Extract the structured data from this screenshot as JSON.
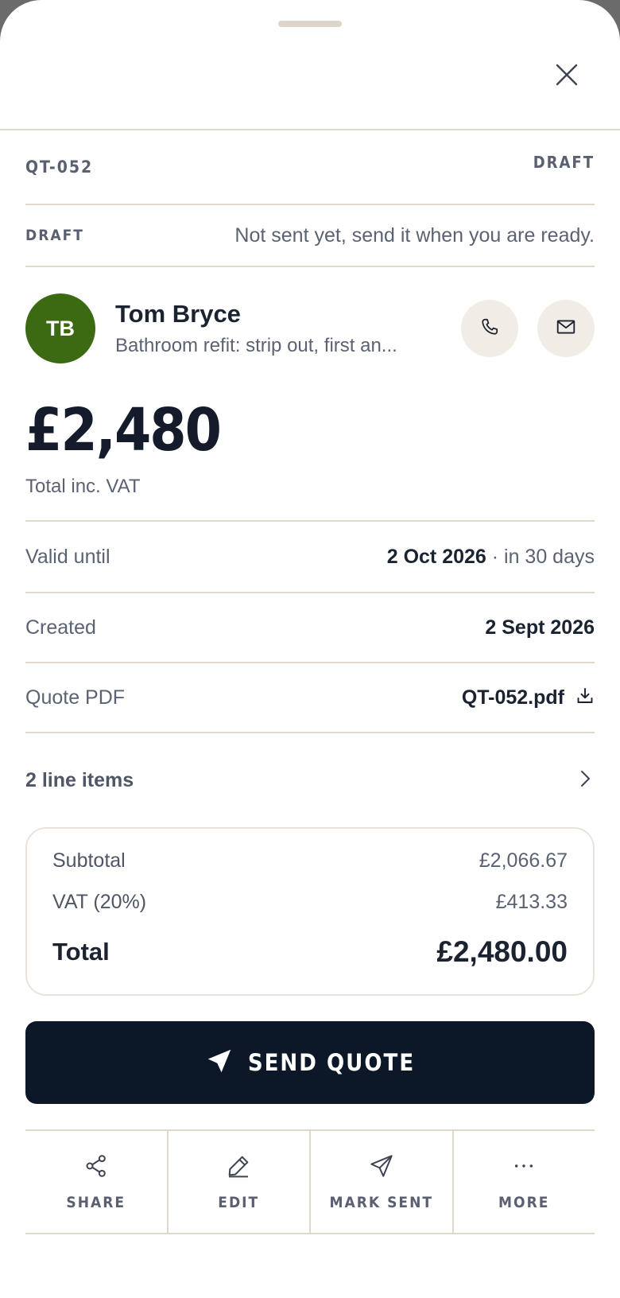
{
  "quote": {
    "ref": "QT-052",
    "status": "DRAFT",
    "state_tag": "DRAFT",
    "state_message": "Not sent yet, send it when you are ready."
  },
  "client": {
    "initials": "TB",
    "name": "Tom Bryce",
    "job": "Bathroom refit: strip out, first an..."
  },
  "amount": {
    "value": "£2,480",
    "label": "Total inc. VAT"
  },
  "details": {
    "valid_label": "Valid until",
    "valid_date": "2 Oct 2026",
    "valid_extra": " · in 30 days",
    "created_label": "Created",
    "created_date": "2 Sept 2026",
    "pdf_label": "Quote PDF",
    "pdf_file": "QT-052.pdf"
  },
  "line_items": {
    "label": "2 line items"
  },
  "totals": {
    "subtotal_label": "Subtotal",
    "subtotal_value": "£2,066.67",
    "vat_label": "VAT (20%)",
    "vat_value": "£413.33",
    "total_label": "Total",
    "total_value": "£2,480.00"
  },
  "send": {
    "label": "SEND QUOTE"
  },
  "actions": {
    "share": "SHARE",
    "edit": "EDIT",
    "mark_sent": "MARK SENT",
    "more": "MORE"
  },
  "colors": {
    "avatar": "#3b6a12",
    "primary_button": "#0c1828",
    "divider": "#e1d8cc",
    "icon_button_bg": "#f1ece6"
  },
  "icons": {
    "close": "close-icon",
    "phone": "phone-icon",
    "email": "mail-icon",
    "download": "download-icon",
    "chevron": "chevron-right-icon",
    "send": "send-icon",
    "share": "share-icon",
    "edit": "pencil-icon",
    "mark_sent": "paper-plane-icon",
    "more": "more-icon"
  }
}
